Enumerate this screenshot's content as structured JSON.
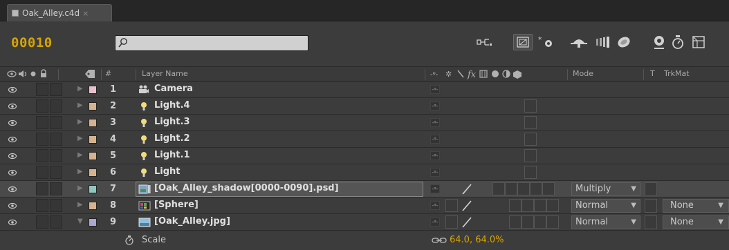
{
  "tab": {
    "title": "Oak_Alley.c4d",
    "close": "×"
  },
  "timecode": "00010",
  "search": {
    "value": "",
    "placeholder": ""
  },
  "columns": {
    "number": "#",
    "layer_name": "Layer Name",
    "mode": "Mode",
    "t": "T",
    "trkmat": "TrkMat"
  },
  "colors": {
    "timecode": "#d9a400",
    "label_pink": "#e8bfcf",
    "label_tan": "#d6b38f",
    "label_teal": "#8fc7c0",
    "label_lavender": "#a9a9d2"
  },
  "layers": [
    {
      "num": "1",
      "name": "Camera",
      "icon": "camera-icon",
      "label_color": "#e8bfcf"
    },
    {
      "num": "2",
      "name": "Light.4",
      "icon": "light-icon",
      "label_color": "#d6b38f"
    },
    {
      "num": "3",
      "name": "Light.3",
      "icon": "light-icon",
      "label_color": "#d6b38f"
    },
    {
      "num": "4",
      "name": "Light.2",
      "icon": "light-icon",
      "label_color": "#d6b38f"
    },
    {
      "num": "5",
      "name": "Light.1",
      "icon": "light-icon",
      "label_color": "#d6b38f"
    },
    {
      "num": "6",
      "name": "Light",
      "icon": "light-icon",
      "label_color": "#d6b38f"
    },
    {
      "num": "7",
      "name": "[Oak_Alley_shadow[0000-0090].psd]",
      "icon": "image-sequence-icon",
      "label_color": "#8fc7c0",
      "mode": "Multiply"
    },
    {
      "num": "8",
      "name": "[Sphere]",
      "icon": "precomp-icon",
      "label_color": "#d6b38f",
      "mode": "Normal",
      "trkmat": "None"
    },
    {
      "num": "9",
      "name": "[Oak_Alley.jpg]",
      "icon": "image-icon",
      "label_color": "#a9a9d2",
      "mode": "Normal",
      "trkmat": "None"
    }
  ],
  "property": {
    "name": "Scale",
    "value": "64.0, 64.0%"
  }
}
